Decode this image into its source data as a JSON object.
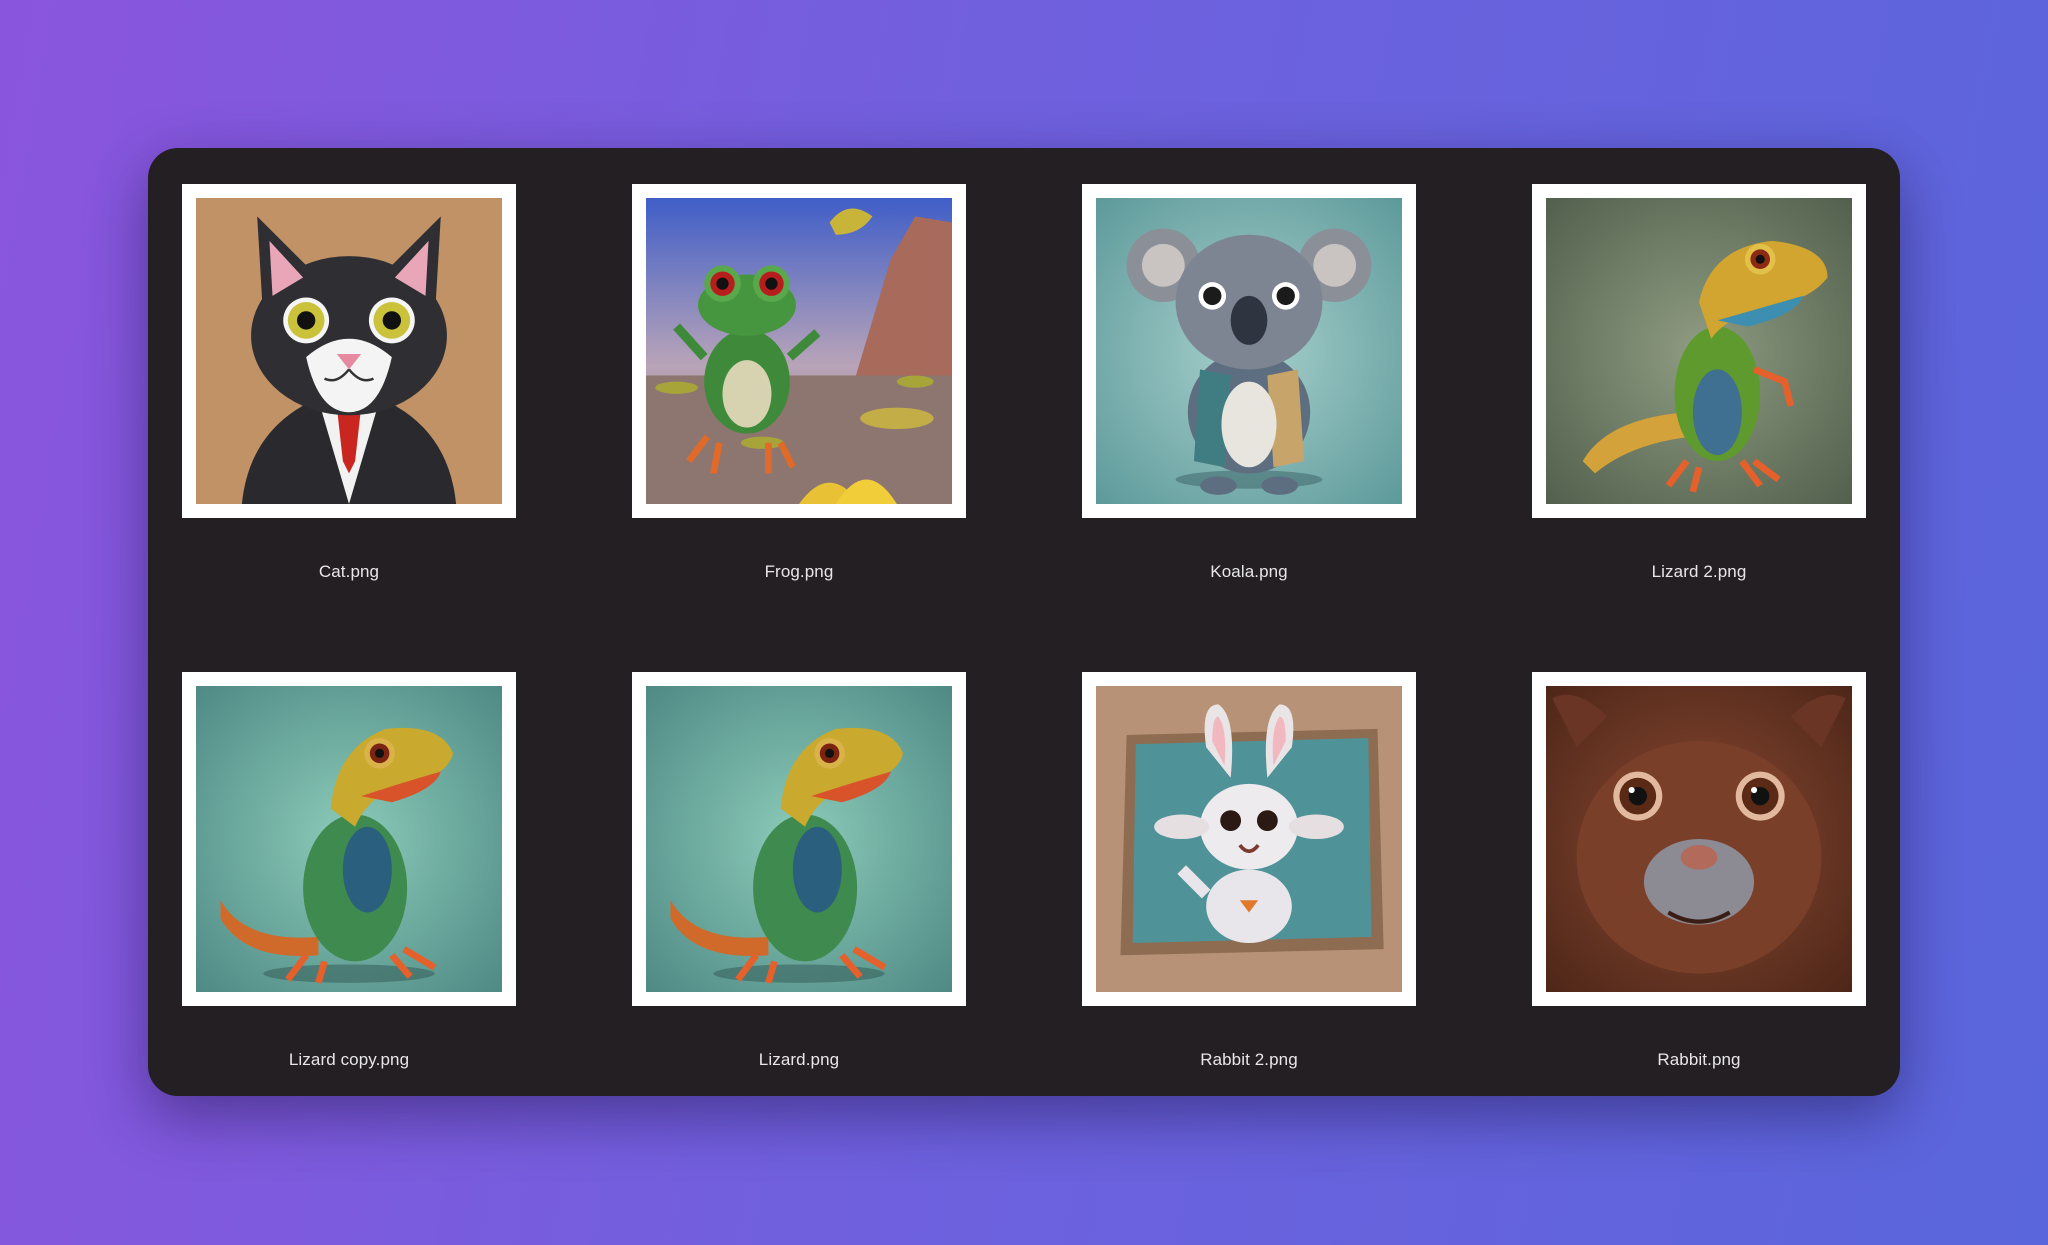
{
  "files": [
    {
      "name": "Cat.png",
      "icon": "cat-thumbnail-icon"
    },
    {
      "name": "Frog.png",
      "icon": "frog-thumbnail-icon"
    },
    {
      "name": "Koala.png",
      "icon": "koala-thumbnail-icon"
    },
    {
      "name": "Lizard 2.png",
      "icon": "lizard-thumbnail-icon"
    },
    {
      "name": "Lizard copy.png",
      "icon": "lizard-thumbnail-icon"
    },
    {
      "name": "Lizard.png",
      "icon": "lizard-thumbnail-icon"
    },
    {
      "name": "Rabbit 2.png",
      "icon": "rabbit-thumbnail-icon"
    },
    {
      "name": "Rabbit.png",
      "icon": "rabbit-thumbnail-icon"
    }
  ],
  "colors": {
    "window_background": "#231f22",
    "label_text": "#e9e6ea",
    "thumbnail_border": "#ffffff"
  }
}
